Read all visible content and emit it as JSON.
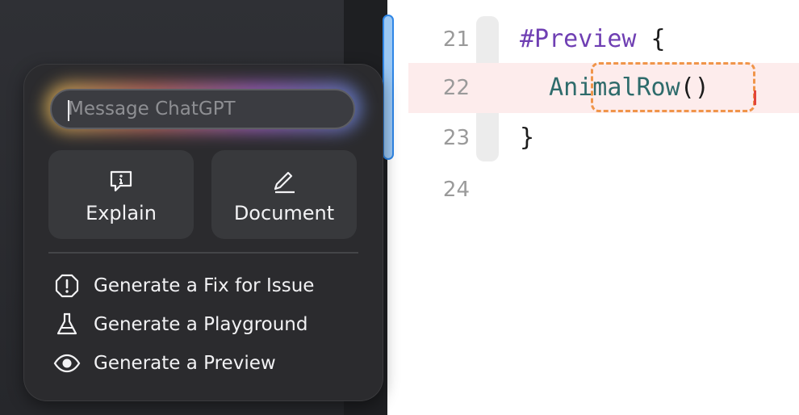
{
  "chat": {
    "input_placeholder": "Message ChatGPT"
  },
  "actions": {
    "explain_label": "Explain",
    "document_label": "Document"
  },
  "menu": {
    "items": [
      {
        "label": "Generate a Fix for Issue",
        "icon": "exclamation-circle-icon"
      },
      {
        "label": "Generate a Playground",
        "icon": "flask-icon"
      },
      {
        "label": "Generate a Preview",
        "icon": "eye-icon"
      }
    ]
  },
  "editor": {
    "lines": [
      {
        "number": "21",
        "parts": [
          "#Preview",
          " {"
        ]
      },
      {
        "number": "22",
        "parts": [
          "AnimalRow",
          "()"
        ]
      },
      {
        "number": "23",
        "parts": [
          "}"
        ]
      },
      {
        "number": "24",
        "parts": []
      }
    ]
  },
  "colors": {
    "popup_bg": "#2b2b2e",
    "keyword": "#6f3fb3",
    "type": "#2e6b6b",
    "highlight_line": "#fdecec",
    "selection_border": "#f0954a",
    "scroll_accent": "#2f86e6"
  }
}
